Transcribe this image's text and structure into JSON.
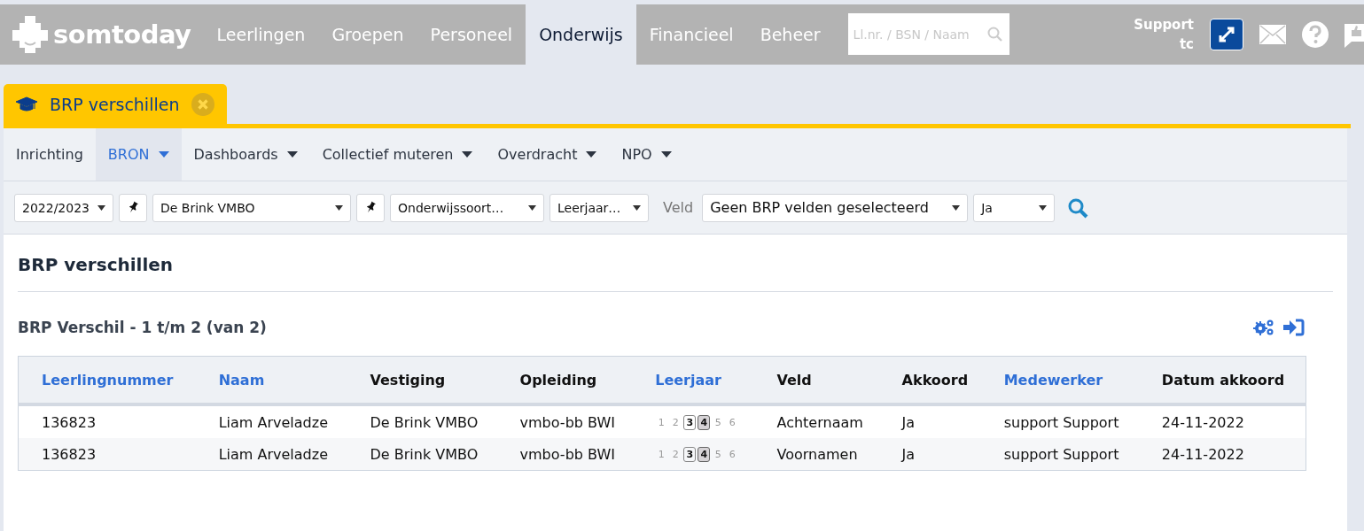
{
  "header": {
    "logo": "somtoday",
    "nav": [
      {
        "label": "Leerlingen",
        "selected": false
      },
      {
        "label": "Groepen",
        "selected": false
      },
      {
        "label": "Personeel",
        "selected": false
      },
      {
        "label": "Onderwijs",
        "selected": true
      },
      {
        "label": "Financieel",
        "selected": false
      },
      {
        "label": "Beheer",
        "selected": false
      }
    ],
    "search": {
      "placeholder": "Ll.nr. / BSN / Naam"
    },
    "user": {
      "name": "Support",
      "initials": "tc"
    }
  },
  "page_tab": {
    "title": "BRP verschillen"
  },
  "submenu": [
    {
      "label": "Inrichting",
      "selected": false,
      "dropdown": false
    },
    {
      "label": "BRON",
      "selected": true,
      "dropdown": true
    },
    {
      "label": "Dashboards",
      "selected": false,
      "dropdown": true
    },
    {
      "label": "Collectief muteren",
      "selected": false,
      "dropdown": true
    },
    {
      "label": "Overdracht",
      "selected": false,
      "dropdown": true
    },
    {
      "label": "NPO",
      "selected": false,
      "dropdown": true
    }
  ],
  "filters": [
    {
      "kind": "select",
      "value": "2022/2023"
    },
    {
      "kind": "pin"
    },
    {
      "kind": "select",
      "value": "De Brink VMBO"
    },
    {
      "kind": "pin"
    },
    {
      "kind": "select",
      "value": "Onderwijssoort…"
    },
    {
      "kind": "select",
      "value": "Leerjaar…"
    },
    {
      "kind": "label",
      "value": "Veld"
    },
    {
      "kind": "select",
      "value": "Geen BRP velden geselecteerd"
    },
    {
      "kind": "select",
      "value": "Ja"
    },
    {
      "kind": "search"
    }
  ],
  "heading": "BRP verschillen",
  "table": {
    "title": "BRP Verschil - 1 t/m 2 (van 2)",
    "columns": [
      {
        "label": "Leerlingnummer",
        "sortable": true
      },
      {
        "label": "Naam",
        "sortable": true
      },
      {
        "label": "Vestiging",
        "sortable": false
      },
      {
        "label": "Opleiding",
        "sortable": false
      },
      {
        "label": "Leerjaar",
        "sortable": true
      },
      {
        "label": "Veld",
        "sortable": false
      },
      {
        "label": "Akkoord",
        "sortable": false
      },
      {
        "label": "Medewerker",
        "sortable": true
      },
      {
        "label": "Datum akkoord",
        "sortable": false
      }
    ],
    "rows": [
      {
        "leerlingnummer": "136823",
        "naam": "Liam Arveladze",
        "vestiging": "De Brink VMBO",
        "opleiding": "vmbo-bb BWI",
        "leerjaar": [
          {
            "label": "1",
            "kind": "off"
          },
          {
            "label": "2",
            "kind": "off"
          },
          {
            "label": "3",
            "kind": "available"
          },
          {
            "label": "4",
            "kind": "current"
          },
          {
            "label": "5",
            "kind": "off"
          },
          {
            "label": "6",
            "kind": "off"
          }
        ],
        "veld": "Achternaam",
        "akkoord": "Ja",
        "medewerker": "support Support",
        "datum_akkoord": "24-11-2022"
      },
      {
        "leerlingnummer": "136823",
        "naam": "Liam Arveladze",
        "vestiging": "De Brink VMBO",
        "opleiding": "vmbo-bb BWI",
        "leerjaar": [
          {
            "label": "1",
            "kind": "off"
          },
          {
            "label": "2",
            "kind": "off"
          },
          {
            "label": "3",
            "kind": "available"
          },
          {
            "label": "4",
            "kind": "current"
          },
          {
            "label": "5",
            "kind": "off"
          },
          {
            "label": "6",
            "kind": "off"
          }
        ],
        "veld": "Voornamen",
        "akkoord": "Ja",
        "medewerker": "support Support",
        "datum_akkoord": "24-11-2022"
      }
    ]
  }
}
